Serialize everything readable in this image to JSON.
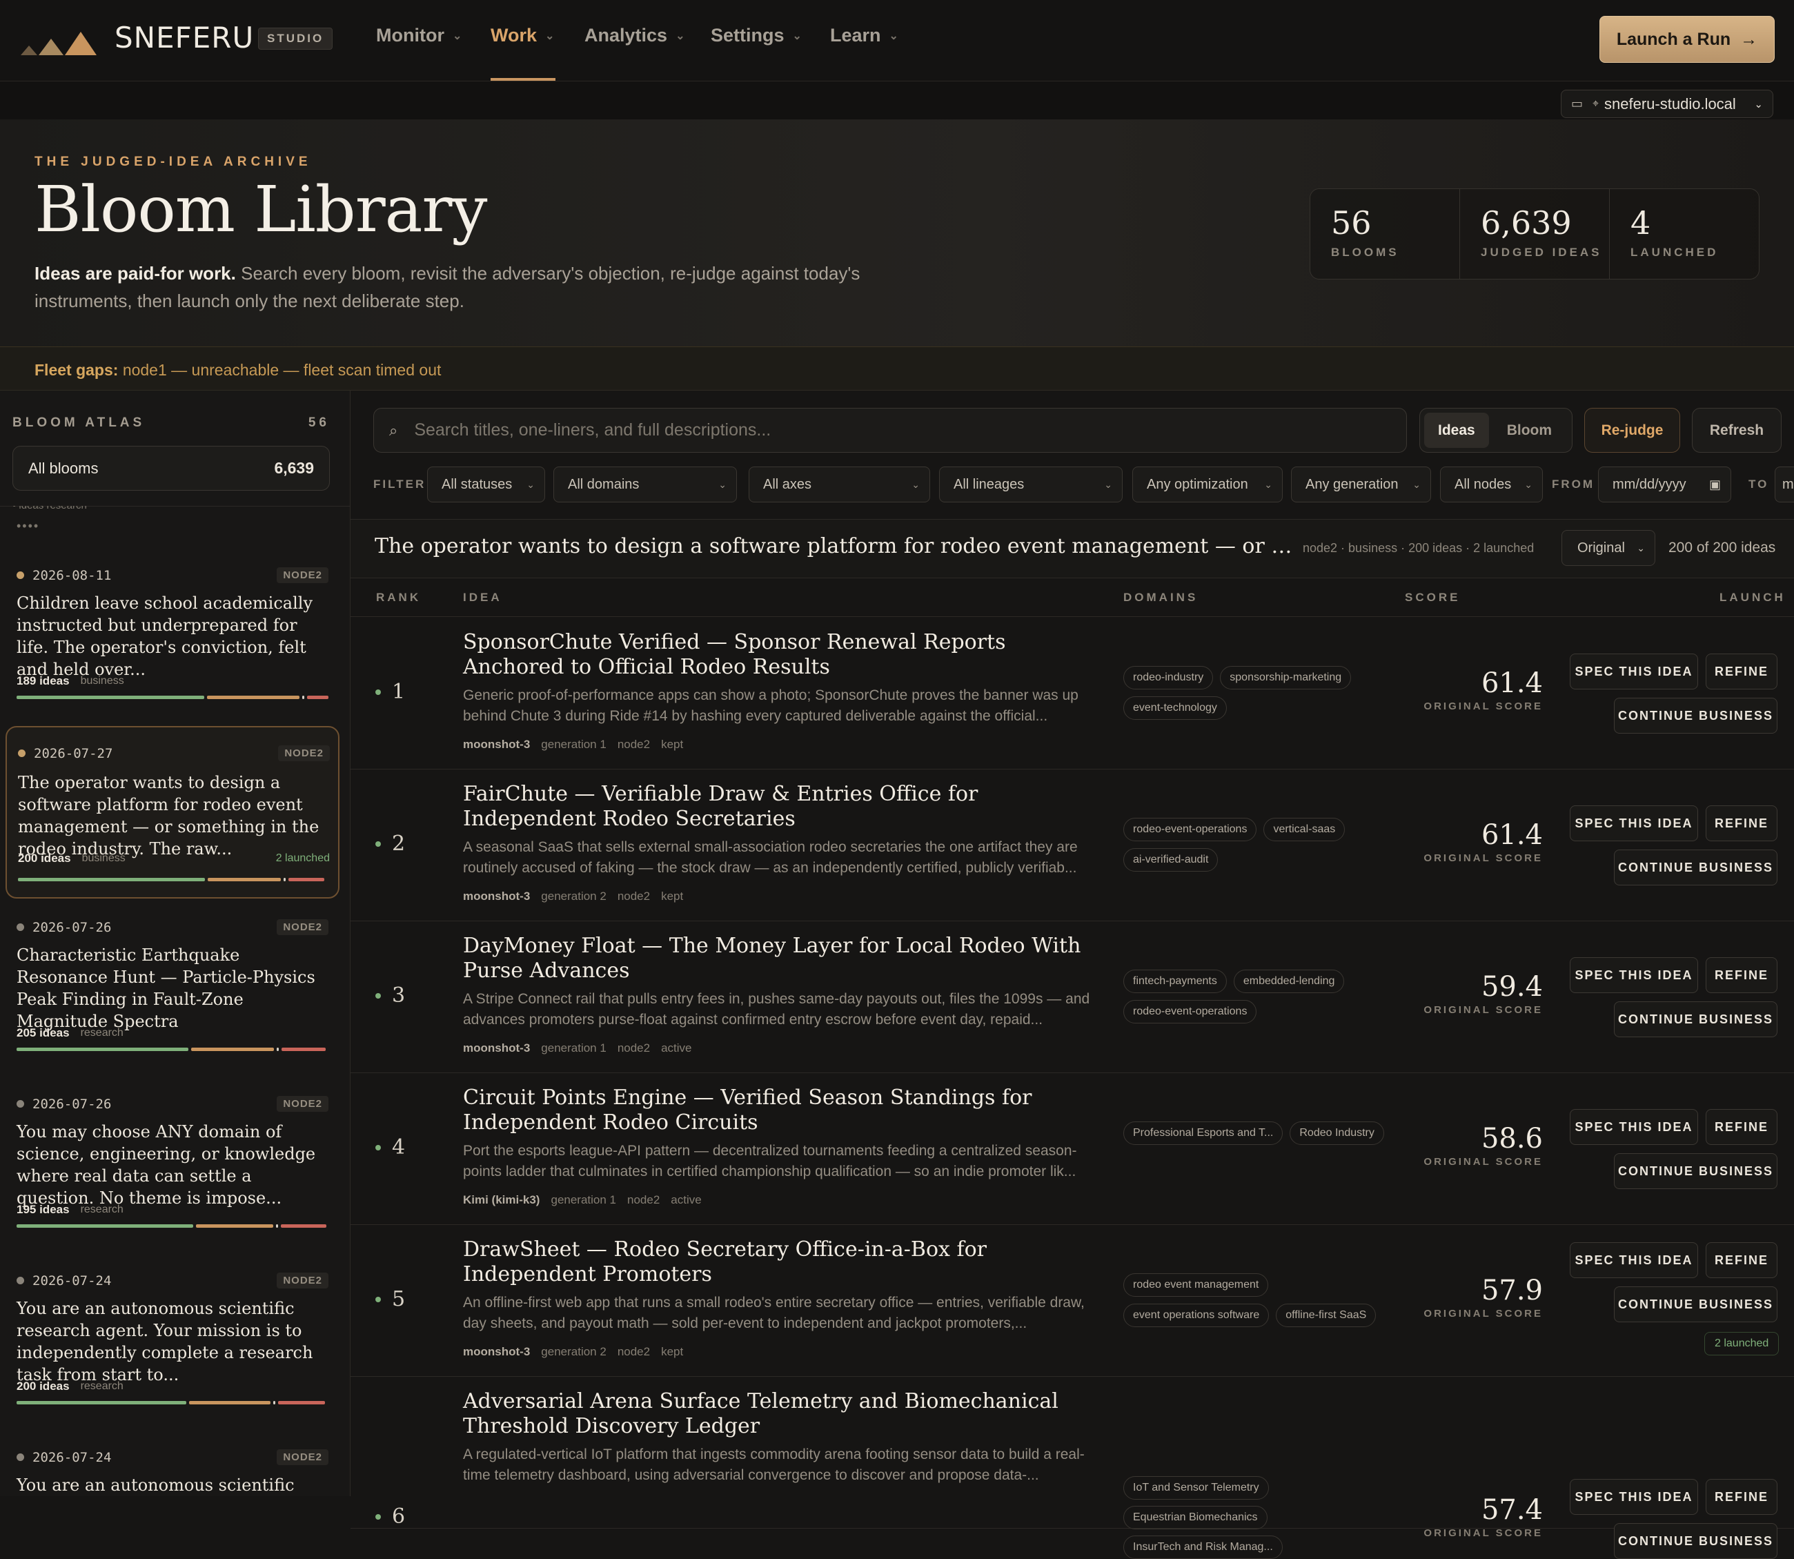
{
  "brand": {
    "name": "SNEFERU",
    "badge": "STUDIO"
  },
  "nav": {
    "items": [
      {
        "label": "Monitor"
      },
      {
        "label": "Work",
        "active": true
      },
      {
        "label": "Analytics"
      },
      {
        "label": "Settings"
      },
      {
        "label": "Learn"
      }
    ],
    "launch_label": "Launch a Run"
  },
  "host": {
    "value": "sneferu-studio.local"
  },
  "hero": {
    "eyebrow": "THE JUDGED-IDEA ARCHIVE",
    "title": "Bloom Library",
    "desc_bold": "Ideas are paid-for work.",
    "desc_rest": " Search every bloom, revisit the adversary's objection, re-judge against today's instruments, then launch only the next deliberate step.",
    "stats": [
      {
        "value": "56",
        "label": "BLOOMS"
      },
      {
        "value": "6,639",
        "label": "JUDGED IDEAS"
      },
      {
        "value": "4",
        "label": "LAUNCHED"
      }
    ]
  },
  "fleet": {
    "label": "Fleet gaps:",
    "text": "node1 — unreachable — fleet scan timed out"
  },
  "sidebar": {
    "heading": "BLOOM ATLAS",
    "count": "56",
    "all_label": "All blooms",
    "all_count": "6,639",
    "clipped_text": "• ideas   research",
    "blooms": [
      {
        "date": "2026-08-11",
        "node": "NODE2",
        "title": "Children leave school academically instructed but underprepared for life. The operator's conviction, felt and held over...",
        "ideas": "189 ideas",
        "domain": "business",
        "launched": ""
      },
      {
        "date": "2026-07-27",
        "node": "NODE2",
        "title": "The operator wants to design a software platform for rodeo event management — or something in the rodeo industry. The raw...",
        "ideas": "200 ideas",
        "domain": "business",
        "launched": "2 launched"
      },
      {
        "date": "2026-07-26",
        "node": "NODE2",
        "title": "Characteristic Earthquake Resonance Hunt — Particle-Physics Peak Finding in Fault-Zone Magnitude Spectra",
        "ideas": "205 ideas",
        "domain": "research",
        "launched": ""
      },
      {
        "date": "2026-07-26",
        "node": "NODE2",
        "title": "You may choose ANY domain of science, engineering, or knowledge where real data can settle a question. No theme is impose...",
        "ideas": "195 ideas",
        "domain": "research",
        "launched": ""
      },
      {
        "date": "2026-07-24",
        "node": "NODE2",
        "title": "You are an autonomous scientific research agent. Your mission is to independently complete a research task from start to...",
        "ideas": "200 ideas",
        "domain": "research",
        "launched": ""
      },
      {
        "date": "2026-07-24",
        "node": "NODE2",
        "title": "You are an autonomous scientific research",
        "ideas": "",
        "domain": "",
        "launched": ""
      }
    ]
  },
  "toolbar": {
    "search_placeholder": "Search titles, one-liners, and full descriptions...",
    "view_ideas": "Ideas",
    "view_bloom": "Bloom",
    "rejudge": "Re-judge",
    "refresh": "Refresh"
  },
  "filters": {
    "label": "FILTER",
    "statuses": "All statuses",
    "domains": "All domains",
    "axes": "All axes",
    "lineages": "All lineages",
    "optimization": "Any optimization",
    "generation": "Any generation",
    "nodes": "All nodes",
    "from_label": "FROM",
    "date_placeholder": "mm/dd/yyyy",
    "to_label": "TO"
  },
  "bloom_header": {
    "title": "The operator wants to design a software platform for rodeo event management — or something in the rodeo industry.",
    "meta": "node2 · business · 200 ideas · 2 launched",
    "score_mode": "Original",
    "count": "200 of 200 ideas"
  },
  "table": {
    "headers": {
      "rank": "RANK",
      "idea": "IDEA",
      "domains": "DOMAINS",
      "score": "SCORE",
      "launch": "LAUNCH"
    },
    "score_label": "ORIGINAL SCORE",
    "action_spec": "SPEC THIS IDEA",
    "action_refine": "REFINE",
    "action_continue": "CONTINUE BUSINESS",
    "rows": [
      {
        "rank": "1",
        "title": "SponsorChute Verified — Sponsor Renewal Reports Anchored to Official Rodeo Results",
        "desc": "Generic proof-of-performance apps can show a photo; SponsorChute proves the banner was up behind Chute 3 during Ride #14 by hashing every captured deliverable against the official...",
        "model": "moonshot-3",
        "generation": "generation 1",
        "node": "node2",
        "status": "kept",
        "tags": [
          "rodeo-industry",
          "sponsorship-marketing",
          "event-technology"
        ],
        "score": "61.4",
        "launched": ""
      },
      {
        "rank": "2",
        "title": "FairChute — Verifiable Draw & Entries Office for Independent Rodeo Secretaries",
        "desc": "A seasonal SaaS that sells external small-association rodeo secretaries the one artifact they are routinely accused of faking — the stock draw — as an independently certified, publicly verifiab...",
        "model": "moonshot-3",
        "generation": "generation 2",
        "node": "node2",
        "status": "kept",
        "tags": [
          "rodeo-event-operations",
          "vertical-saas",
          "ai-verified-audit"
        ],
        "score": "61.4",
        "launched": ""
      },
      {
        "rank": "3",
        "title": "DayMoney Float — The Money Layer for Local Rodeo With Purse Advances",
        "desc": "A Stripe Connect rail that pulls entry fees in, pushes same-day payouts out, files the 1099s — and advances promoters purse-float against confirmed entry escrow before event day, repaid...",
        "model": "moonshot-3",
        "generation": "generation 1",
        "node": "node2",
        "status": "active",
        "tags": [
          "fintech-payments",
          "embedded-lending",
          "rodeo-event-operations"
        ],
        "score": "59.4",
        "launched": ""
      },
      {
        "rank": "4",
        "title": "Circuit Points Engine — Verified Season Standings for Independent Rodeo Circuits",
        "desc": "Port the esports league-API pattern — decentralized tournaments feeding a centralized season-points ladder that culminates in certified championship qualification — so an indie promoter lik...",
        "model": "Kimi (kimi-k3)",
        "generation": "generation 1",
        "node": "node2",
        "status": "active",
        "tags": [
          "Professional Esports and T...",
          "Rodeo Industry"
        ],
        "score": "58.6",
        "launched": ""
      },
      {
        "rank": "5",
        "title": "DrawSheet — Rodeo Secretary Office-in-a-Box for Independent Promoters",
        "desc": "An offline-first web app that runs a small rodeo's entire secretary office — entries, verifiable draw, day sheets, and payout math — sold per-event to independent and jackpot promoters,...",
        "model": "moonshot-3",
        "generation": "generation 2",
        "node": "node2",
        "status": "kept",
        "tags": [
          "rodeo event management",
          "event operations software",
          "offline-first SaaS"
        ],
        "score": "57.9",
        "launched": "2 launched"
      },
      {
        "rank": "6",
        "title": "Adversarial Arena Surface Telemetry and Biomechanical Threshold Discovery Ledger",
        "desc": "A regulated-vertical IoT platform that ingests commodity arena footing sensor data to build a real-time telemetry dashboard, using adversarial convergence to discover and propose data-...",
        "model": "",
        "generation": "",
        "node": "",
        "status": "",
        "tags": [
          "IoT and Sensor Telemetry",
          "Equestrian Biomechanics",
          "InsurTech and Risk Manag..."
        ],
        "score": "57.4",
        "launched": ""
      }
    ]
  },
  "colors": {
    "accent": "#d9a46a",
    "bg": "#161514",
    "green": "#7fb07a",
    "bar_green": "#7fb07a",
    "bar_tan": "#c9955e",
    "bar_red": "#c9655a"
  }
}
